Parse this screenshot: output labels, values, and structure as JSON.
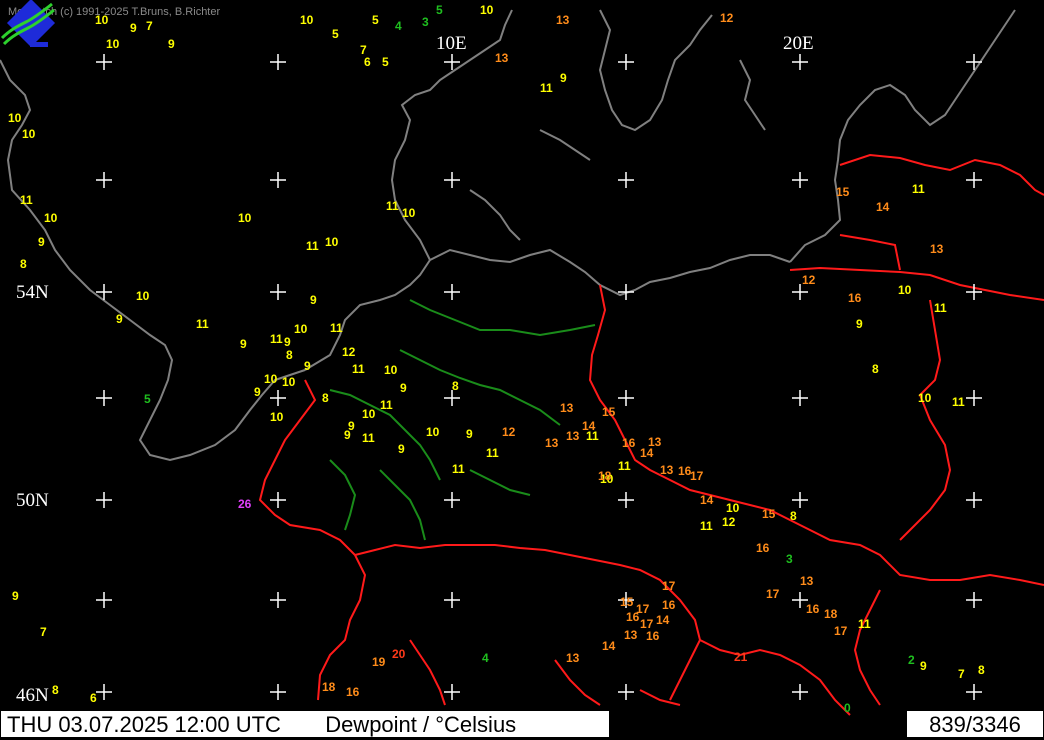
{
  "copyright": "MetWatch  (c) 1991-2025 T.Bruns, B.Richter",
  "labels": {
    "lon_10e": "10E",
    "lon_20e": "20E",
    "lat_54n": "54N",
    "lat_50n": "50N",
    "lat_46n": "46N"
  },
  "footer": {
    "datetime": "THU 03.07.2025 12:00 UTC",
    "parameter": "Dewpoint / °Celsius",
    "count": "839/3346"
  },
  "colors": {
    "background": "#000000",
    "coastline": "#808080",
    "border": "#ff1a1a",
    "river": "#1a8c1a",
    "grid_cross": "#ffffff",
    "low": "#ffff00",
    "mid": "#ff8c1a",
    "high": "#ff3a1a",
    "very_low": "#1fbf1f",
    "extreme": "#e040fb"
  },
  "stations": [
    {
      "v": "10",
      "c": "yellow"
    },
    {
      "v": "9",
      "c": "yellow"
    },
    {
      "v": "10",
      "c": "yellow"
    },
    {
      "v": "7",
      "c": "yellow"
    },
    {
      "v": "9",
      "c": "yellow"
    },
    {
      "v": "5",
      "c": "yellow"
    },
    {
      "v": "4",
      "c": "green"
    },
    {
      "v": "3",
      "c": "green"
    },
    {
      "v": "5",
      "c": "green"
    },
    {
      "v": "10",
      "c": "yellow"
    },
    {
      "v": "12",
      "c": "orange"
    },
    {
      "v": "13",
      "c": "orange"
    },
    {
      "v": "10",
      "c": "yellow"
    },
    {
      "v": "5",
      "c": "yellow"
    },
    {
      "v": "7",
      "c": "yellow"
    },
    {
      "v": "6",
      "c": "yellow"
    },
    {
      "v": "5",
      "c": "yellow"
    },
    {
      "v": "13",
      "c": "orange"
    },
    {
      "v": "9",
      "c": "yellow"
    },
    {
      "v": "11",
      "c": "yellow"
    },
    {
      "v": "10",
      "c": "yellow"
    },
    {
      "v": "10",
      "c": "yellow"
    },
    {
      "v": "11",
      "c": "yellow"
    },
    {
      "v": "10",
      "c": "yellow"
    },
    {
      "v": "9",
      "c": "yellow"
    },
    {
      "v": "10",
      "c": "yellow"
    },
    {
      "v": "11",
      "c": "yellow"
    },
    {
      "v": "10",
      "c": "yellow"
    },
    {
      "v": "11",
      "c": "yellow"
    },
    {
      "v": "10",
      "c": "yellow"
    },
    {
      "v": "8",
      "c": "yellow"
    },
    {
      "v": "10",
      "c": "yellow"
    },
    {
      "v": "9",
      "c": "yellow"
    },
    {
      "v": "11",
      "c": "yellow"
    },
    {
      "v": "9",
      "c": "yellow"
    },
    {
      "v": "11",
      "c": "yellow"
    },
    {
      "v": "10",
      "c": "yellow"
    },
    {
      "v": "9",
      "c": "yellow"
    },
    {
      "v": "8",
      "c": "yellow"
    },
    {
      "v": "9",
      "c": "yellow"
    },
    {
      "v": "10",
      "c": "yellow"
    },
    {
      "v": "11",
      "c": "yellow"
    },
    {
      "v": "9",
      "c": "yellow"
    },
    {
      "v": "8",
      "c": "yellow"
    },
    {
      "v": "10",
      "c": "yellow"
    },
    {
      "v": "11",
      "c": "yellow"
    },
    {
      "v": "12",
      "c": "yellow"
    },
    {
      "v": "11",
      "c": "yellow"
    },
    {
      "v": "9",
      "c": "yellow"
    },
    {
      "v": "10",
      "c": "yellow"
    },
    {
      "v": "9",
      "c": "yellow"
    },
    {
      "v": "8",
      "c": "yellow"
    },
    {
      "v": "10",
      "c": "yellow"
    },
    {
      "v": "9",
      "c": "yellow"
    },
    {
      "v": "10",
      "c": "yellow"
    },
    {
      "v": "12",
      "c": "orange"
    },
    {
      "v": "11",
      "c": "yellow"
    },
    {
      "v": "9",
      "c": "yellow"
    },
    {
      "v": "10",
      "c": "yellow"
    },
    {
      "v": "9",
      "c": "yellow"
    },
    {
      "v": "11",
      "c": "yellow"
    },
    {
      "v": "9",
      "c": "yellow"
    },
    {
      "v": "13",
      "c": "orange"
    },
    {
      "v": "11",
      "c": "yellow"
    },
    {
      "v": "14",
      "c": "orange"
    },
    {
      "v": "13",
      "c": "orange"
    },
    {
      "v": "15",
      "c": "orange"
    },
    {
      "v": "11",
      "c": "yellow"
    },
    {
      "v": "13",
      "c": "orange"
    },
    {
      "v": "13",
      "c": "orange"
    },
    {
      "v": "16",
      "c": "orange"
    },
    {
      "v": "14",
      "c": "orange"
    },
    {
      "v": "11",
      "c": "yellow"
    },
    {
      "v": "10",
      "c": "yellow"
    },
    {
      "v": "16",
      "c": "orange"
    },
    {
      "v": "13",
      "c": "orange"
    },
    {
      "v": "17",
      "c": "orange"
    },
    {
      "v": "10",
      "c": "yellow"
    },
    {
      "v": "12",
      "c": "yellow"
    },
    {
      "v": "8",
      "c": "yellow"
    },
    {
      "v": "13",
      "c": "orange"
    },
    {
      "v": "11",
      "c": "yellow"
    },
    {
      "v": "14",
      "c": "orange"
    },
    {
      "v": "15",
      "c": "orange"
    },
    {
      "v": "16",
      "c": "orange"
    },
    {
      "v": "17",
      "c": "orange"
    },
    {
      "v": "16",
      "c": "orange"
    },
    {
      "v": "18",
      "c": "orange"
    },
    {
      "v": "17",
      "c": "orange"
    },
    {
      "v": "11",
      "c": "yellow"
    },
    {
      "v": "14",
      "c": "orange"
    },
    {
      "v": "16",
      "c": "orange"
    },
    {
      "v": "17",
      "c": "orange"
    },
    {
      "v": "15",
      "c": "orange"
    },
    {
      "v": "16",
      "c": "orange"
    },
    {
      "v": "17",
      "c": "orange"
    },
    {
      "v": "13",
      "c": "orange"
    },
    {
      "v": "16",
      "c": "orange"
    },
    {
      "v": "14",
      "c": "orange"
    },
    {
      "v": "13",
      "c": "orange"
    },
    {
      "v": "18",
      "c": "orange"
    },
    {
      "v": "17",
      "c": "orange"
    },
    {
      "v": "20",
      "c": "red"
    },
    {
      "v": "19",
      "c": "orange"
    },
    {
      "v": "16",
      "c": "orange"
    },
    {
      "v": "18",
      "c": "orange"
    },
    {
      "v": "21",
      "c": "red"
    },
    {
      "v": "26",
      "c": "magenta"
    },
    {
      "v": "9",
      "c": "yellow"
    },
    {
      "v": "7",
      "c": "yellow"
    },
    {
      "v": "8",
      "c": "yellow"
    },
    {
      "v": "6",
      "c": "yellow"
    },
    {
      "v": "5",
      "c": "green"
    },
    {
      "v": "4",
      "c": "green"
    },
    {
      "v": "3",
      "c": "green"
    },
    {
      "v": "0",
      "c": "green"
    },
    {
      "v": "2",
      "c": "green"
    },
    {
      "v": "7",
      "c": "yellow"
    },
    {
      "v": "8",
      "c": "yellow"
    },
    {
      "v": "9",
      "c": "yellow"
    },
    {
      "v": "12",
      "c": "orange"
    },
    {
      "v": "11",
      "c": "yellow"
    },
    {
      "v": "14",
      "c": "orange"
    },
    {
      "v": "13",
      "c": "orange"
    },
    {
      "v": "15",
      "c": "orange"
    },
    {
      "v": "16",
      "c": "orange"
    },
    {
      "v": "10",
      "c": "yellow"
    },
    {
      "v": "11",
      "c": "yellow"
    },
    {
      "v": "9",
      "c": "yellow"
    },
    {
      "v": "8",
      "c": "yellow"
    },
    {
      "v": "10",
      "c": "yellow"
    },
    {
      "v": "11",
      "c": "yellow"
    }
  ]
}
